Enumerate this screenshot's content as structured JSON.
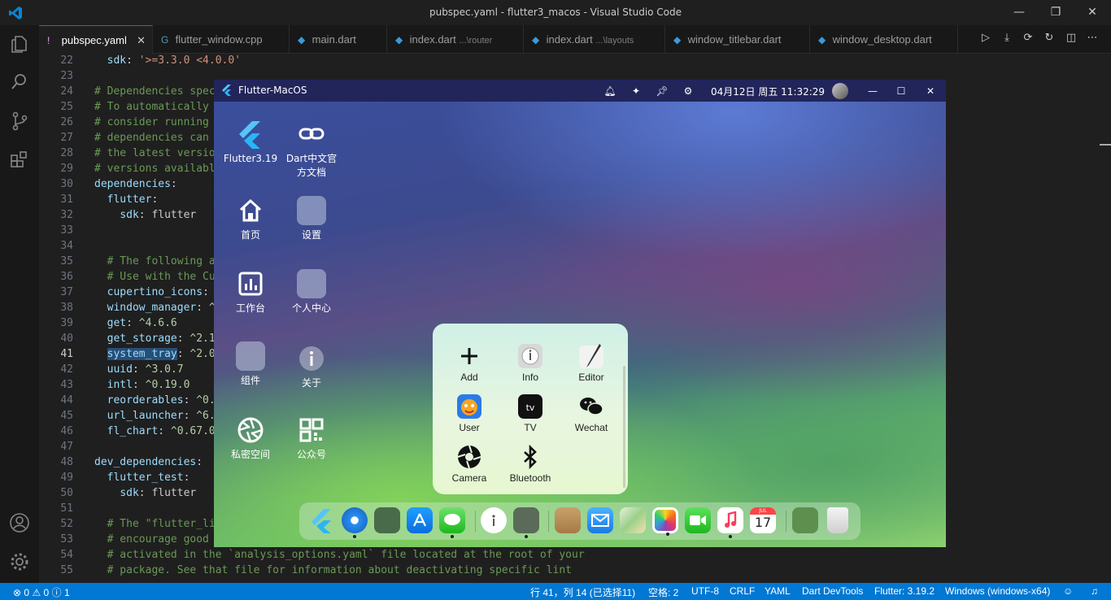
{
  "window": {
    "title": "pubspec.yaml - flutter3_macos - Visual Studio Code"
  },
  "tabs": [
    {
      "label": "pubspec.yaml",
      "sub": "",
      "icon": "!",
      "active": true
    },
    {
      "label": "flutter_window.cpp",
      "sub": "",
      "icon": "G"
    },
    {
      "label": "main.dart",
      "sub": "",
      "icon": "◆"
    },
    {
      "label": "index.dart",
      "sub": "...\\router",
      "icon": "◆"
    },
    {
      "label": "index.dart",
      "sub": "...\\layouts",
      "icon": "◆"
    },
    {
      "label": "window_titlebar.dart",
      "sub": "",
      "icon": "◆"
    },
    {
      "label": "window_desktop.dart",
      "sub": "",
      "icon": "◆"
    }
  ],
  "code": {
    "lines": [
      {
        "n": "22",
        "t": "  sdk: '>=3.3.0 <4.0.0'"
      },
      {
        "n": "23",
        "t": ""
      },
      {
        "n": "24",
        "t": "# Dependencies spec"
      },
      {
        "n": "25",
        "t": "# To automatically"
      },
      {
        "n": "26",
        "t": "# consider running"
      },
      {
        "n": "27",
        "t": "# dependencies can"
      },
      {
        "n": "28",
        "t": "# the latest versio"
      },
      {
        "n": "29",
        "t": "# versions availabl"
      },
      {
        "n": "30",
        "t": "dependencies:"
      },
      {
        "n": "31",
        "t": "  flutter:"
      },
      {
        "n": "32",
        "t": "    sdk: flutter"
      },
      {
        "n": "33",
        "t": ""
      },
      {
        "n": "34",
        "t": ""
      },
      {
        "n": "35",
        "t": "  # The following a"
      },
      {
        "n": "36",
        "t": "  # Use with the Cu"
      },
      {
        "n": "37",
        "t": "  cupertino_icons: "
      },
      {
        "n": "38",
        "t": "  window_manager: ^"
      },
      {
        "n": "39",
        "t": "  get: ^4.6.6"
      },
      {
        "n": "40",
        "t": "  get_storage: ^2.1"
      },
      {
        "n": "41",
        "t": "  system_tray: ^2.0"
      },
      {
        "n": "42",
        "t": "  uuid: ^3.0.7"
      },
      {
        "n": "43",
        "t": "  intl: ^0.19.0"
      },
      {
        "n": "44",
        "t": "  reorderables: ^0."
      },
      {
        "n": "45",
        "t": "  url_launcher: ^6."
      },
      {
        "n": "46",
        "t": "  fl_chart: ^0.67.0"
      },
      {
        "n": "47",
        "t": ""
      },
      {
        "n": "48",
        "t": "dev_dependencies:"
      },
      {
        "n": "49",
        "t": "  flutter_test:"
      },
      {
        "n": "50",
        "t": "    sdk: flutter"
      },
      {
        "n": "51",
        "t": ""
      },
      {
        "n": "52",
        "t": "  # The \"flutter_li"
      },
      {
        "n": "53",
        "t": "  # encourage good "
      },
      {
        "n": "54",
        "t": "  # activated in the `analysis_options.yaml` file located at the root of your"
      },
      {
        "n": "55",
        "t": "  # package. See that file for information about deactivating specific lint"
      }
    ],
    "current_line": "41"
  },
  "flutter_app": {
    "title": "Flutter-MacOS",
    "datetime": "04月12日 周五 11:32:29",
    "desktop_icons": [
      {
        "label": "Flutter3.19",
        "icon": "flutter-logo-icon"
      },
      {
        "label": "Dart中文官方文档",
        "icon": "link-icon"
      },
      {
        "label": "首页",
        "icon": "home-icon"
      },
      {
        "label": "设置",
        "icon": "folder-icon"
      },
      {
        "label": "工作台",
        "icon": "chart-icon"
      },
      {
        "label": "个人中心",
        "icon": "folder-icon"
      },
      {
        "label": "组件",
        "icon": "folder-icon"
      },
      {
        "label": "关于",
        "icon": "info-icon"
      },
      {
        "label": "私密空间",
        "icon": "camera-aperture-icon"
      },
      {
        "label": "公众号",
        "icon": "qrcode-icon"
      }
    ],
    "popup_items": [
      {
        "label": "Add",
        "icon": "plus-icon"
      },
      {
        "label": "Info",
        "icon": "info-icon"
      },
      {
        "label": "Editor",
        "icon": "pen-icon"
      },
      {
        "label": "User",
        "icon": "user-avatar-icon"
      },
      {
        "label": "TV",
        "icon": "appletv-icon"
      },
      {
        "label": "Wechat",
        "icon": "wechat-icon"
      },
      {
        "label": "Camera",
        "icon": "camera-aperture-icon"
      },
      {
        "label": "Bluetooth",
        "icon": "bluetooth-icon"
      }
    ],
    "dock_icons": [
      "flutter-icon",
      "safari-icon",
      "folder-icon",
      "appstore-icon",
      "messages-icon",
      "info-icon",
      "folder-icon",
      "contacts-icon",
      "mail-icon",
      "maps-icon",
      "photos-icon",
      "facetime-icon",
      "music-icon",
      "calendar-icon",
      "folder-icon",
      "trash-icon"
    ],
    "calendar": {
      "month": "JUL",
      "day": "17"
    }
  },
  "status": {
    "errors": "0",
    "warnings": "0",
    "info": "1",
    "cursor": "行 41，列 14 (已选择11)",
    "spaces": "空格: 2",
    "encoding": "UTF-8",
    "eol": "CRLF",
    "lang": "YAML",
    "devtools": "Dart DevTools",
    "flutter": "Flutter: 3.19.2",
    "platform": "Windows (windows-x64)"
  },
  "colors": {
    "statusbar": "#0078d4",
    "accent": "#0078d4",
    "app_titlebar": "#21255a"
  }
}
